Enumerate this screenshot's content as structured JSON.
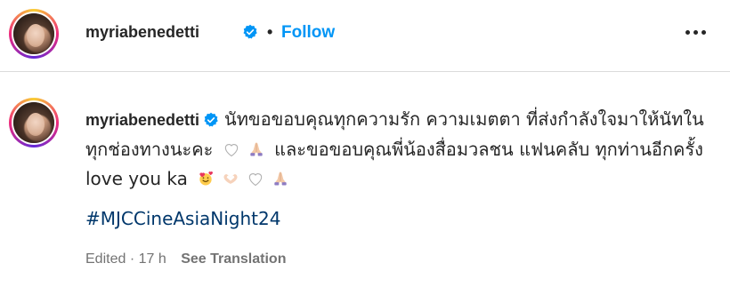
{
  "header": {
    "username": "myriabenedetti",
    "separator": "•",
    "follow_label": "Follow",
    "more_icon": "more-options-icon"
  },
  "post": {
    "username": "myriabenedetti",
    "caption_part1": "นัทขอขอบคุณทุกความรัก ความเมตตา ที่ส่งกำลังใจมาให้นัทในทุกช่องทางนะคะ",
    "caption_part2": "และขอขอบคุณพี่น้องสื่อมวลชน แฟนคลับ ทุกท่านอีกครั้ง love you ka",
    "emojis": [
      "white-heart",
      "folded-hands",
      "smiling-face-with-hearts",
      "heart-hands",
      "white-heart",
      "folded-hands"
    ],
    "hashtag": "#MJCCineAsiaNight24",
    "edited_label": "Edited",
    "time_sep": "·",
    "time_ago": "17 h",
    "see_translation": "See Translation"
  },
  "colors": {
    "accent": "#0095f6",
    "verified": "#0095f6",
    "hashtag": "#00376b",
    "muted": "#737373",
    "text": "#262626"
  }
}
